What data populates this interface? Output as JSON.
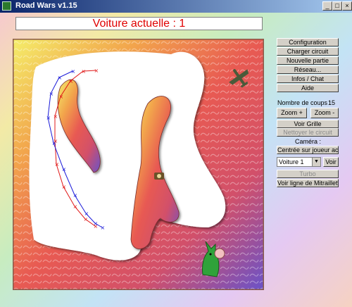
{
  "window": {
    "title": "Road Wars v1.15",
    "minimize": "_",
    "maximize": "□",
    "close": "×"
  },
  "status": {
    "text": "Voiture actuelle : 1"
  },
  "menu": {
    "configuration": "Configuration",
    "charger": "Charger circuit",
    "nouvelle": "Nouvelle partie",
    "reseau": "Réseau...",
    "infos": "Infos / Chat",
    "aide": "Aide"
  },
  "game": {
    "coups_label": "Nombre de coups :",
    "coups_value": "15",
    "zoom_in": "Zoom  +",
    "zoom_out": "Zoom  -",
    "voir_grille": "Voir Grille",
    "nettoyer": "Nettoyer le circuit",
    "camera_label": "Caméra :",
    "centrer": "Centrée sur joueur actif",
    "voiture_select": "Voiture 1",
    "voir": "Voir",
    "turbo": "Turbo",
    "mitraillette": "Voir ligne de Mitraillette"
  },
  "colors": {
    "red_car": "#e01818",
    "blue_car": "#1818d8",
    "status_text": "#e00000"
  }
}
